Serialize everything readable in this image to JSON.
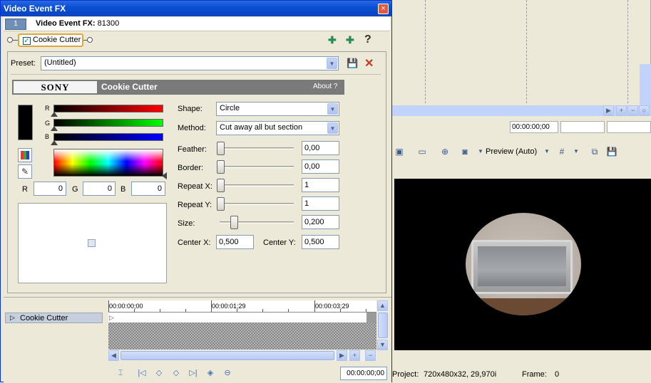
{
  "window": {
    "title": "Video Event FX",
    "close_icon": "×"
  },
  "header": {
    "track_number": "1",
    "label": "Video Event FX:",
    "value": "81300"
  },
  "chain": {
    "plugin_label": "Cookie Cutter",
    "checked": true,
    "add_icon": "plug-add-icon",
    "remove_icon": "plug-remove-icon",
    "help": "?"
  },
  "preset": {
    "label": "Preset:",
    "value": "(Untitled)"
  },
  "banner": {
    "brand": "SONY",
    "plugin": "Cookie Cutter",
    "about": "About   ?"
  },
  "color": {
    "r_letter": "R",
    "g_letter": "G",
    "b_letter": "B",
    "r_value": "0",
    "g_value": "0",
    "b_value": "0"
  },
  "params": {
    "shape_label": "Shape:",
    "shape_value": "Circle",
    "method_label": "Method:",
    "method_value": "Cut away all but section",
    "feather_label": "Feather:",
    "feather_value": "0,00",
    "feather_level": 0,
    "border_label": "Border:",
    "border_value": "0,00",
    "border_level": 0,
    "repeatx_label": "Repeat X:",
    "repeatx_value": "1",
    "repeatx_level": 0,
    "repeaty_label": "Repeat Y:",
    "repeaty_value": "1",
    "repeaty_level": 0,
    "size_label": "Size:",
    "size_value": "0,200",
    "size_level": 0.2,
    "centerx_label": "Center X:",
    "centerx_value": "0,500",
    "centery_label": "Center Y:",
    "centery_value": "0,500"
  },
  "keyframes": {
    "track_label": "Cookie Cutter",
    "ruler": [
      "00:00:00;00",
      "00:00:01;29",
      "00:00:03;29"
    ],
    "time": "00:00:00;00"
  },
  "right": {
    "time1": "00:00:00;00",
    "preview_label": "Preview (Auto)",
    "project_label": "Project:",
    "project_value": "720x480x32, 29,970i",
    "frame_label": "Frame:",
    "frame_value": "0"
  },
  "colors": {
    "titlebar": "#0b4fd4",
    "accent_border": "#e0a83c"
  }
}
